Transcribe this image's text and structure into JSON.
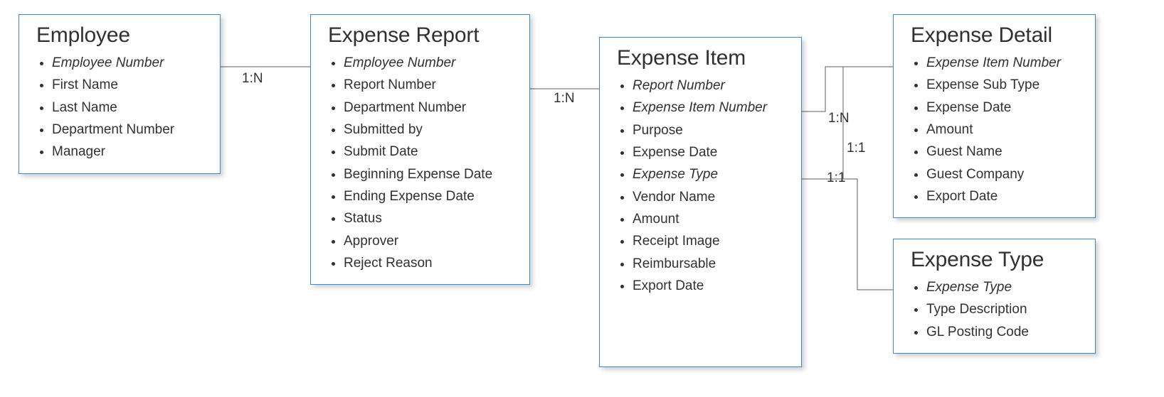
{
  "entities": {
    "employee": {
      "title": "Employee",
      "attrs": [
        {
          "label": "Employee Number",
          "key": true
        },
        {
          "label": "First Name",
          "key": false
        },
        {
          "label": "Last Name",
          "key": false
        },
        {
          "label": "Department Number",
          "key": false
        },
        {
          "label": "Manager",
          "key": false
        }
      ]
    },
    "expense_report": {
      "title": "Expense Report",
      "attrs": [
        {
          "label": "Employee Number",
          "key": true
        },
        {
          "label": "Report Number",
          "key": false
        },
        {
          "label": "Department Number",
          "key": false
        },
        {
          "label": "Submitted by",
          "key": false
        },
        {
          "label": "Submit Date",
          "key": false
        },
        {
          "label": "Beginning Expense Date",
          "key": false
        },
        {
          "label": "Ending Expense Date",
          "key": false
        },
        {
          "label": "Status",
          "key": false
        },
        {
          "label": "Approver",
          "key": false
        },
        {
          "label": "Reject Reason",
          "key": false
        }
      ]
    },
    "expense_item": {
      "title": "Expense Item",
      "attrs": [
        {
          "label": "Report Number",
          "key": true
        },
        {
          "label": "Expense Item Number",
          "key": true
        },
        {
          "label": "Purpose",
          "key": false
        },
        {
          "label": "Expense Date",
          "key": false
        },
        {
          "label": "Expense Type",
          "key": true
        },
        {
          "label": "Vendor Name",
          "key": false
        },
        {
          "label": "Amount",
          "key": false
        },
        {
          "label": "Receipt Image",
          "key": false
        },
        {
          "label": "Reimbursable",
          "key": false
        },
        {
          "label": "Export Date",
          "key": false
        }
      ]
    },
    "expense_detail": {
      "title": "Expense Detail",
      "attrs": [
        {
          "label": "Expense Item Number",
          "key": true
        },
        {
          "label": "Expense Sub Type",
          "key": false
        },
        {
          "label": "Expense Date",
          "key": false
        },
        {
          "label": "Amount",
          "key": false
        },
        {
          "label": "Guest Name",
          "key": false
        },
        {
          "label": "Guest Company",
          "key": false
        },
        {
          "label": "Export Date",
          "key": false
        }
      ]
    },
    "expense_type": {
      "title": "Expense Type",
      "attrs": [
        {
          "label": "Expense Type",
          "key": true
        },
        {
          "label": "Type Description",
          "key": false
        },
        {
          "label": "GL Posting Code",
          "key": false
        }
      ]
    }
  },
  "relationships": {
    "r1": "1:N",
    "r2": "1:N",
    "r3": "1:N",
    "r4": "1:1",
    "r5": "1:1"
  }
}
